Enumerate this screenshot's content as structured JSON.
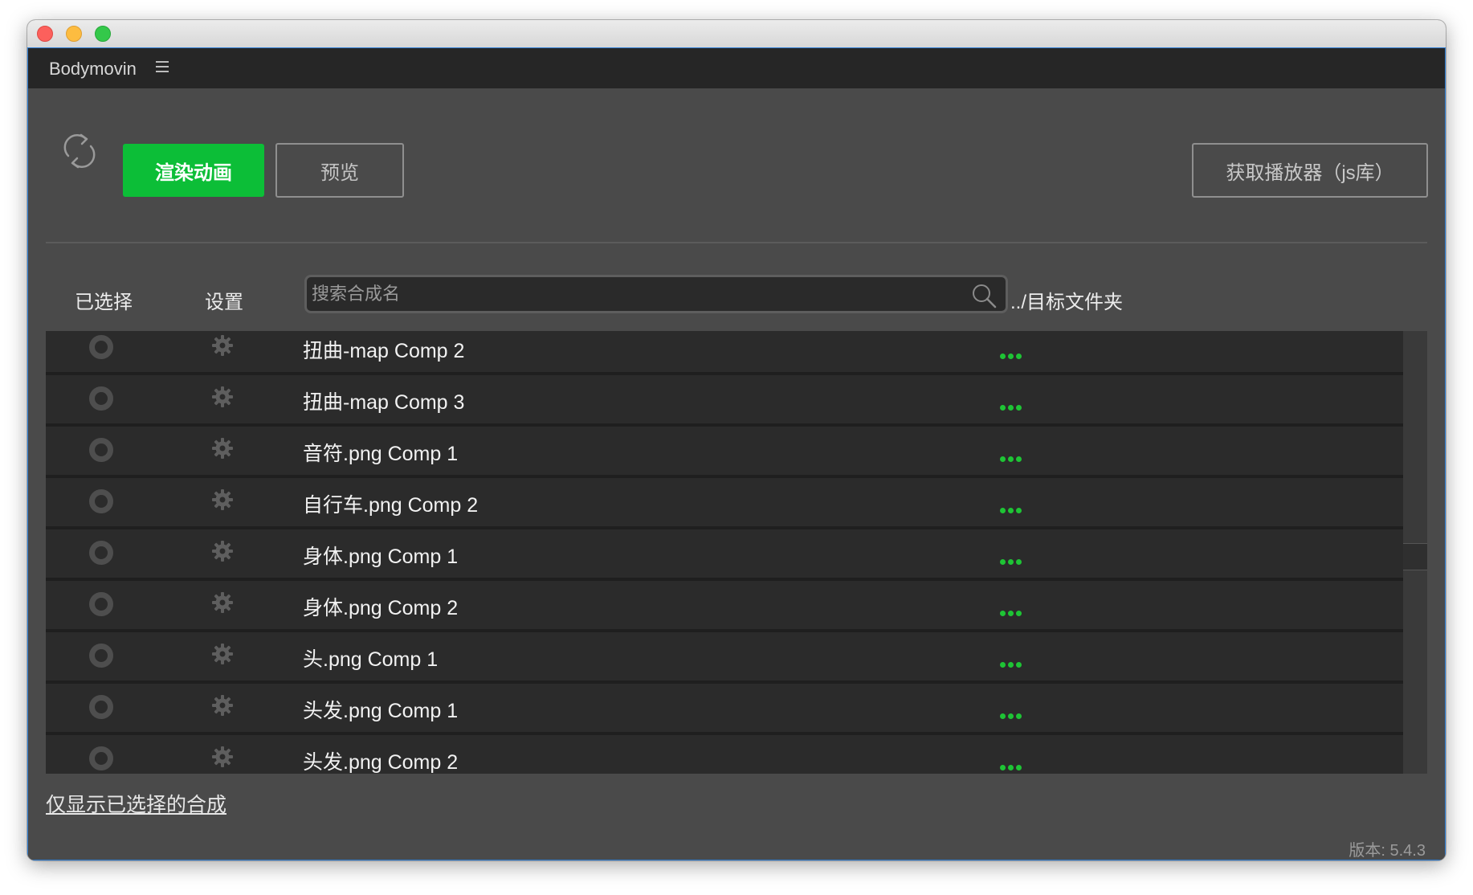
{
  "window": {
    "title": ""
  },
  "panel": {
    "title": "Bodymovin",
    "menu_icon": "hamburger-icon"
  },
  "toolbar": {
    "refresh_icon": "refresh-icon",
    "render_label": "渲染动画",
    "preview_label": "预览",
    "get_player_label": "获取播放器（js库）"
  },
  "columns": {
    "selected": "已选择",
    "settings": "设置",
    "destination": "../目标文件夹"
  },
  "search": {
    "placeholder": "搜索合成名",
    "value": "",
    "icon": "search-icon"
  },
  "compositions": [
    {
      "name": "扭曲-map Comp 2",
      "selected": false
    },
    {
      "name": "扭曲-map Comp 3",
      "selected": false
    },
    {
      "name": "音符.png Comp 1",
      "selected": false
    },
    {
      "name": "自行车.png Comp 2",
      "selected": false
    },
    {
      "name": "身体.png Comp 1",
      "selected": false
    },
    {
      "name": "身体.png Comp 2",
      "selected": false
    },
    {
      "name": "头.png Comp 1",
      "selected": false
    },
    {
      "name": "头发.png Comp 1",
      "selected": false
    },
    {
      "name": "头发.png Comp 2",
      "selected": false
    }
  ],
  "footer": {
    "filter_link": "仅显示已选择的合成",
    "version": "版本: 5.4.3"
  },
  "colors": {
    "accent": "#0cbe37",
    "dots": "#1ec435",
    "background": "#4a4a4a",
    "row": "#2b2b2b"
  }
}
